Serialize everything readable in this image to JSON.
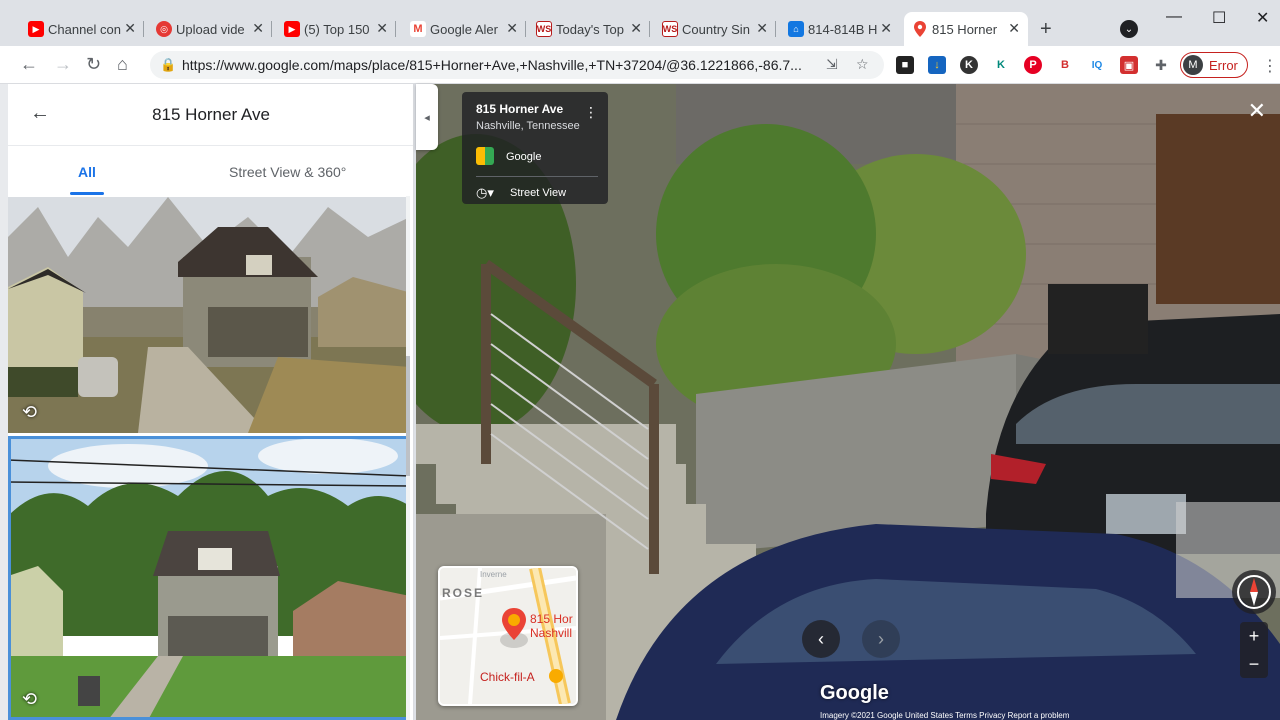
{
  "browser": {
    "tabs": [
      {
        "title": "Channel con",
        "favicon": "youtube-icon",
        "color": "#ff0000"
      },
      {
        "title": "Upload vide",
        "favicon": "upload-icon",
        "color": "#e53935"
      },
      {
        "title": "(5) Top 150",
        "favicon": "youtube-icon",
        "color": "#ff0000"
      },
      {
        "title": "Google Aler",
        "favicon": "gmail-icon",
        "color": "#ea4335"
      },
      {
        "title": "Today's Top",
        "favicon": "ws-icon",
        "color": "#b71c1c"
      },
      {
        "title": "Country Sin",
        "favicon": "ws-icon",
        "color": "#b71c1c"
      },
      {
        "title": "814-814B H",
        "favicon": "zillow-icon",
        "color": "#1277e1"
      },
      {
        "title": "815 Horner",
        "favicon": "maps-pin-icon",
        "color": "#34a853",
        "active": true
      }
    ],
    "url": "https://www.google.com/maps/place/815+Horner+Ave,+Nashville,+TN+37204/@36.1221866,-86.7...",
    "profile": {
      "initial": "M",
      "status": "Error"
    }
  },
  "left_panel": {
    "title": "815 Horner Ave",
    "tabs": [
      "All",
      "Street View & 360°"
    ],
    "active_tab": "All"
  },
  "street_view": {
    "address": "815 Horner Ave",
    "city": "Nashville, Tennessee",
    "provider": "Google",
    "mode": "Street View",
    "watermark": "Google",
    "minimap": {
      "area_label": "ROSE",
      "pin_label_line1": "815 Hor",
      "pin_label_line2": "Nashvill",
      "poi": "Chick-fil-A",
      "street_label": "Inverne"
    },
    "footer": "Imagery ©2021 Google   United States   Terms   Privacy   Report a problem"
  }
}
